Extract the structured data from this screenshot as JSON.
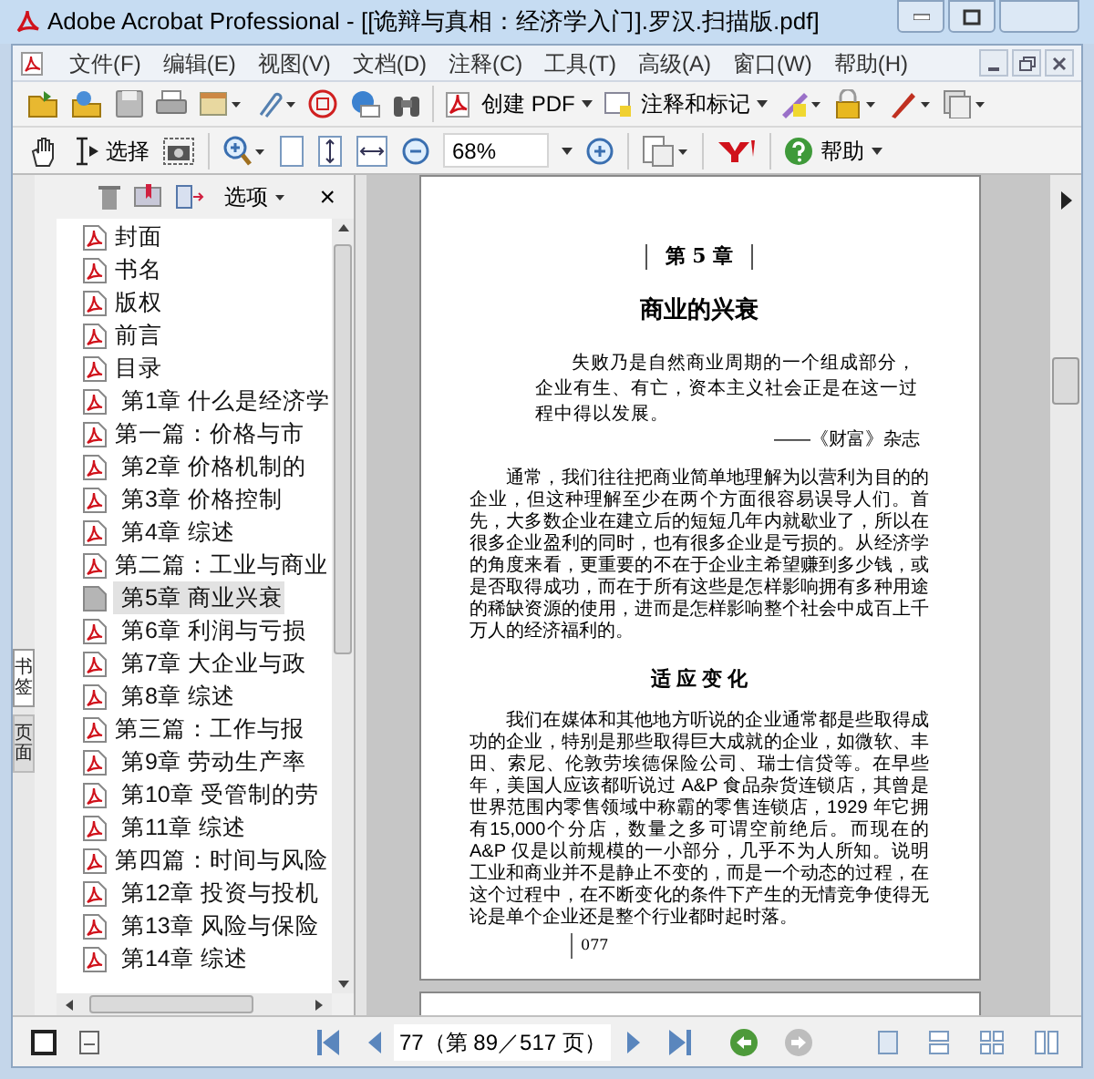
{
  "window": {
    "title": "Adobe Acrobat Professional - [[诡辩与真相：经济学入门].罗汉.扫描版.pdf]"
  },
  "menu": [
    "文件(F)",
    "编辑(E)",
    "视图(V)",
    "文档(D)",
    "注释(C)",
    "工具(T)",
    "高级(A)",
    "窗口(W)",
    "帮助(H)"
  ],
  "toolbar": {
    "create_pdf": "创建 PDF",
    "comment_markup": "注释和标记"
  },
  "navigation_toolbar": {
    "select": "选择",
    "zoom": "68%",
    "help": "帮助"
  },
  "sidebar": {
    "options": "选项",
    "close": "×",
    "tabs": [
      {
        "label": "书签",
        "selected": true
      },
      {
        "label": "页面",
        "selected": false
      }
    ],
    "bookmarks": [
      {
        "text": "封面",
        "selected": false
      },
      {
        "text": "书名",
        "selected": false
      },
      {
        "text": "版权",
        "selected": false
      },
      {
        "text": "前言",
        "selected": false
      },
      {
        "text": "目录",
        "selected": false
      },
      {
        "text": " 第1章 什么是经济学",
        "selected": false
      },
      {
        "text": "第一篇：价格与市",
        "selected": false
      },
      {
        "text": " 第2章 价格机制的",
        "selected": false
      },
      {
        "text": " 第3章 价格控制",
        "selected": false
      },
      {
        "text": " 第4章 综述",
        "selected": false
      },
      {
        "text": "第二篇：工业与商业",
        "selected": false
      },
      {
        "text": " 第5章 商业兴衰",
        "selected": true
      },
      {
        "text": " 第6章 利润与亏损",
        "selected": false
      },
      {
        "text": " 第7章 大企业与政",
        "selected": false
      },
      {
        "text": " 第8章 综述",
        "selected": false
      },
      {
        "text": "第三篇：工作与报",
        "selected": false
      },
      {
        "text": " 第9章 劳动生产率",
        "selected": false
      },
      {
        "text": " 第10章 受管制的劳",
        "selected": false
      },
      {
        "text": " 第11章 综述",
        "selected": false
      },
      {
        "text": "第四篇：时间与风险",
        "selected": false
      },
      {
        "text": " 第12章 投资与投机",
        "selected": false
      },
      {
        "text": " 第13章 风险与保险",
        "selected": false
      },
      {
        "text": " 第14章 综述",
        "selected": false
      }
    ]
  },
  "document": {
    "chapter": "第 5 章",
    "title": "商业的兴衰",
    "epigraph": "失败乃是自然商业周期的一个组成部分，企业有生、有亡，资本主义社会正是在这一过程中得以发展。",
    "epigraph_source": "——《财富》杂志",
    "paragraphs": [
      "通常，我们往往把商业简单地理解为以营利为目的的企业，但这种理解至少在两个方面很容易误导人们。首先，大多数企业在建立后的短短几年内就歇业了，所以在很多企业盈利的同时，也有很多企业是亏损的。从经济学的角度来看，更重要的不在于企业主希望赚到多少钱，或是否取得成功，而在于所有这些是怎样影响拥有多种用途的稀缺资源的使用，进而是怎样影响整个社会中成百上千万人的经济福利的。"
    ],
    "section_heading": "适 应 变 化",
    "section_paragraphs": [
      "我们在媒体和其他地方听说的企业通常都是些取得成功的企业，特别是那些取得巨大成就的企业，如微软、丰田、索尼、伦敦劳埃德保险公司、瑞士信贷等。在早些年，美国人应该都听说过 A&P 食品杂货连锁店，其曾是世界范围内零售领域中称霸的零售连锁店，1929 年它拥有15,000个分店，数量之多可谓空前绝后。而现在的 A&P 仅是以前规模的一小部分，几乎不为人所知。说明工业和商业并不是静止不变的，而是一个动态的过程，在这个过程中，在不断变化的条件下产生的无情竞争使得无论是单个企业还是整个行业都时起时落。"
    ],
    "page_number": "077"
  },
  "status_bar": {
    "page_field": "77（第 89／517 页）"
  }
}
